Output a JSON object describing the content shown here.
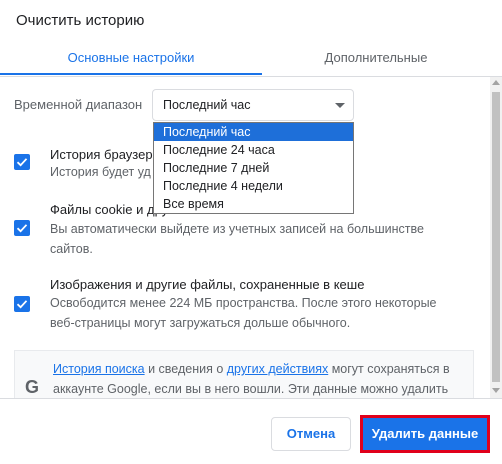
{
  "dialog": {
    "title": "Очистить историю"
  },
  "tabs": [
    {
      "label": "Основные настройки",
      "active": true
    },
    {
      "label": "Дополнительные",
      "active": false
    }
  ],
  "time_range": {
    "label": "Временной диапазон",
    "selected": "Последний час",
    "options": [
      "Последний час",
      "Последние 24 часа",
      "Последние 7 дней",
      "Последние 4 недели",
      "Все время"
    ]
  },
  "items": [
    {
      "title": "История браузера",
      "description": "История будет уд",
      "checked": true
    },
    {
      "title": "Файлы cookie и другие данные сайтов",
      "description": "Вы автоматически выйдете из учетных записей на большинстве сайтов.",
      "checked": true
    },
    {
      "title": "Изображения и другие файлы, сохраненные в кеше",
      "description": "Освободится менее 224 МБ пространства. Позже этого некоторые веб-страницы могут загружаться дольше обычного.",
      "checked": true
    }
  ],
  "item2_desc_line1": "Вы автоматически выйдете из учетных записей на большинстве",
  "item2_desc_line2": "сайтов.",
  "item3_desc_line1": "Освободится менее 224 МБ пространства. После этого некоторые",
  "item3_desc_line2": "веб-страницы могут загружаться дольше обычного.",
  "item1_title_visible": "История браузера",
  "item1_desc_visible": "История будет уд",
  "item2_title_visible": "Файлы cookie и другие",
  "info": {
    "link1": "История поиска",
    "text1": " и сведения о ",
    "link2": "других действиях",
    "text2": " могут сохраняться в",
    "line2": "аккаунте Google, если вы в него вошли. Эти данные можно удалить"
  },
  "footer": {
    "cancel_label": "Отмена",
    "delete_label": "Удалить данные"
  },
  "colors": {
    "accent": "#1a73e8",
    "highlight_border": "#e0001b"
  }
}
